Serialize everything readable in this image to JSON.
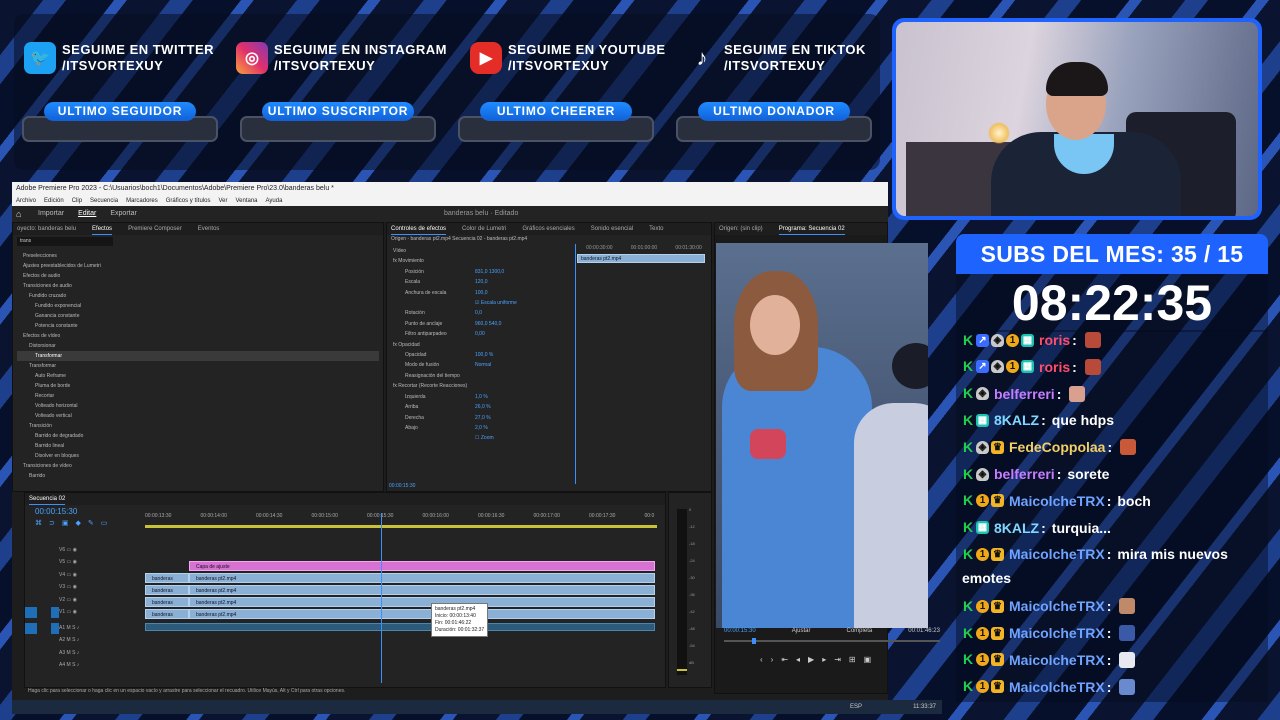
{
  "socials": [
    {
      "icon": "twitter-icon",
      "glyph": "🐦",
      "line1": "SEGUIME EN TWITTER",
      "line2": "/ITSVORTEXUY"
    },
    {
      "icon": "instagram-icon",
      "glyph": "◎",
      "line1": "SEGUIME EN INSTAGRAM",
      "line2": "/ITSVORTEXUY"
    },
    {
      "icon": "youtube-icon",
      "glyph": "▶",
      "line1": "SEGUIME EN YOUTUBE",
      "line2": "/ITSVORTEXUY"
    },
    {
      "icon": "tiktok-icon",
      "glyph": "♪",
      "line1": "SEGUIME EN TIKTOK",
      "line2": "/ITSVORTEXUY"
    }
  ],
  "pills": [
    "ULTIMO SEGUIDOR",
    "ULTIMO SUSCRIPTOR",
    "ULTIMO CHEERER",
    "ULTIMO DONADOR"
  ],
  "subs_label": "SUBS DEL MES: 35 / 15",
  "timer": "08:22:35",
  "chat": [
    {
      "user": "roris",
      "color": "#ff4d6a",
      "text": "",
      "badges": [
        "k",
        "a",
        "s",
        "g",
        "t"
      ],
      "emote": "#b84a3a"
    },
    {
      "user": "roris",
      "color": "#ff4d6a",
      "text": "",
      "badges": [
        "k",
        "a",
        "s",
        "g",
        "t"
      ],
      "emote": "#b84a3a"
    },
    {
      "user": "belferreri",
      "color": "#c77dff",
      "text": "",
      "badges": [
        "k",
        "s"
      ],
      "emote": "#d9a090"
    },
    {
      "user": "8KALZ",
      "color": "#7fd8ff",
      "text": "que hdps",
      "badges": [
        "k",
        "t"
      ],
      "emote": ""
    },
    {
      "user": "FedeCoppolaa",
      "color": "#f2d066",
      "text": "",
      "badges": [
        "k",
        "s",
        "o"
      ],
      "emote": "#c85a3a"
    },
    {
      "user": "belferreri",
      "color": "#c77dff",
      "text": "sorete",
      "badges": [
        "k",
        "s"
      ],
      "emote": ""
    },
    {
      "user": "MaicolcheTRX",
      "color": "#6fa3ff",
      "text": "boch",
      "badges": [
        "k",
        "g",
        "o"
      ],
      "emote": ""
    },
    {
      "user": "8KALZ",
      "color": "#7fd8ff",
      "text": "turquia...",
      "badges": [
        "k",
        "t"
      ],
      "emote": ""
    },
    {
      "user": "MaicolcheTRX",
      "color": "#6fa3ff",
      "text": "mira mis nuevos",
      "text2": "emotes",
      "badges": [
        "k",
        "g",
        "o"
      ],
      "emote": ""
    },
    {
      "user": "MaicolcheTRX",
      "color": "#6fa3ff",
      "text": "",
      "badges": [
        "k",
        "g",
        "o"
      ],
      "emote": "#c08a6a"
    },
    {
      "user": "MaicolcheTRX",
      "color": "#6fa3ff",
      "text": "",
      "badges": [
        "k",
        "g",
        "o"
      ],
      "emote": "#3a5aa8"
    },
    {
      "user": "MaicolcheTRX",
      "color": "#6fa3ff",
      "text": "",
      "badges": [
        "k",
        "g",
        "o"
      ],
      "emote": "#e8e8f0"
    },
    {
      "user": "MaicolcheTRX",
      "color": "#6fa3ff",
      "text": "",
      "badges": [
        "k",
        "g",
        "o"
      ],
      "emote": "#6a8ad0"
    }
  ],
  "premiere": {
    "title": "Adobe Premiere Pro 2023 - C:\\Usuarios\\boch1\\Documentos\\Adobe\\Premiere Pro\\23.0\\banderas belu *",
    "menu": [
      "Archivo",
      "Edición",
      "Clip",
      "Secuencia",
      "Marcadores",
      "Gráficos y títulos",
      "Ver",
      "Ventana",
      "Ayuda"
    ],
    "workspace": [
      "Importar",
      "Editar",
      "Exportar"
    ],
    "project": "banderas belu · Editado",
    "effects_tabs": [
      "oyecto: banderas belu",
      "Efectos",
      "Premiere Composer",
      "Eventos"
    ],
    "effects_search": "trans",
    "effects_rows": [
      "Preselecciones",
      "Ajustes preestablecidos de Lumetri",
      "Efectos de audio",
      "Transiciones de audio",
      "Fundido cruzado",
      "Fundido exponencial",
      "Ganancia constante",
      "Potencia constante",
      "Efectos de vídeo",
      "Distorsionar",
      "Transformar",
      "Transformar",
      "Auto Reframe",
      "Pluma de borde",
      "Recortar",
      "Volteado horizontal",
      "Volteado vertical",
      "Transición",
      "Barrido de degradado",
      "Barrido lineal",
      "Disolver en bloques",
      "Transiciones de vídeo",
      "Barrido"
    ],
    "controls_tabs": [
      "Controles de efectos",
      "Color de Lumetri",
      "Gráficos esenciales",
      "Sonido esencial",
      "Texto"
    ],
    "controls_header": "Origen - banderas pt2.mp4   Secuencia 02 - banderas pt2.mp4",
    "controls_rows": [
      {
        "label": "Vídeo",
        "value": ""
      },
      {
        "label": "fx Movimiento",
        "value": ""
      },
      {
        "label": "Posición",
        "value": "831,0   1300,0"
      },
      {
        "label": "Escala",
        "value": "120,0"
      },
      {
        "label": "Anchura de escala",
        "value": "100,0"
      },
      {
        "label": "",
        "value": "☑ Escala uniforme"
      },
      {
        "label": "Rotación",
        "value": "0,0"
      },
      {
        "label": "Punto de anclaje",
        "value": "960,0   540,0"
      },
      {
        "label": "Filtro antiparpadeo",
        "value": "0,00"
      },
      {
        "label": "fx Opacidad",
        "value": ""
      },
      {
        "label": "Opacidad",
        "value": "100,0 %"
      },
      {
        "label": "Modo de fusión",
        "value": "Normal"
      },
      {
        "label": "Reasignación del tiempo",
        "value": ""
      },
      {
        "label": "fx Recortar (Recorte Reacciones)",
        "value": ""
      },
      {
        "label": "Izquierda",
        "value": "1,0 %"
      },
      {
        "label": "Arriba",
        "value": "26,0 %"
      },
      {
        "label": "Derecha",
        "value": "27,0 %"
      },
      {
        "label": "Abajo",
        "value": "2,0 %"
      },
      {
        "label": "",
        "value": "☐ Zoom"
      }
    ],
    "controls_timecodes": [
      "00:00:30:00",
      "00:01:00:00",
      "00:01:30:00"
    ],
    "controls_clip": "banderas pt2.mp4",
    "controls_current": "00:00:15:30",
    "source_tab": "Origen: (sin clip)",
    "program_tab": "Programa: Secuencia 02",
    "program_timecode": "00:00:15:30",
    "program_fit": "Ajustar",
    "program_quality": "Completa",
    "program_duration": "00:01:46:23",
    "seq_name": "Secuencia 02",
    "seq_timecode": "00:00:15:30",
    "ruler": [
      "00:00:13:30",
      "00:00:14:00",
      "00:00:14:30",
      "00:00:15:00",
      "00:00:15:30",
      "00:00:16:00",
      "00:00:16:30",
      "00:00:17:00",
      "00:00:17:30",
      "00:0"
    ],
    "tracks": [
      "V6",
      "V5",
      "V4",
      "V3",
      "V2",
      "V1",
      "A1",
      "A2",
      "A3",
      "A4"
    ],
    "clip_labels": {
      "adjust": "Capa de ajuste",
      "v4a": "banderas pt2.mp4",
      "v4b": "banderas pt2.mp4",
      "v3a": "banderas pt3.mp4",
      "v3b": "banderas pt2.mp4",
      "v2a": "banderas pt1.mp4",
      "v2b": "banderas pt2.mp4",
      "v1a": "banderas pt2.mp4",
      "v1b": "banderas pt2.mp4"
    },
    "tooltip": [
      "banderas pt2.mp4",
      "Inicio: 00:00:13:40",
      "Fin: 00:01:46:22",
      "Duración: 00:01:32:37"
    ],
    "meter": [
      "0",
      "-12",
      "-18",
      "-24",
      "-30",
      "-36",
      "-42",
      "-48",
      "-54",
      "dB"
    ],
    "status": "Haga clic para seleccionar o haga clic en un espacio vacío y arrastre para seleccionar el recuadro. Utilice Mayús, Alt y Ctrl para otras opciones.",
    "clock": "11:33:37",
    "lang": "ESP"
  }
}
